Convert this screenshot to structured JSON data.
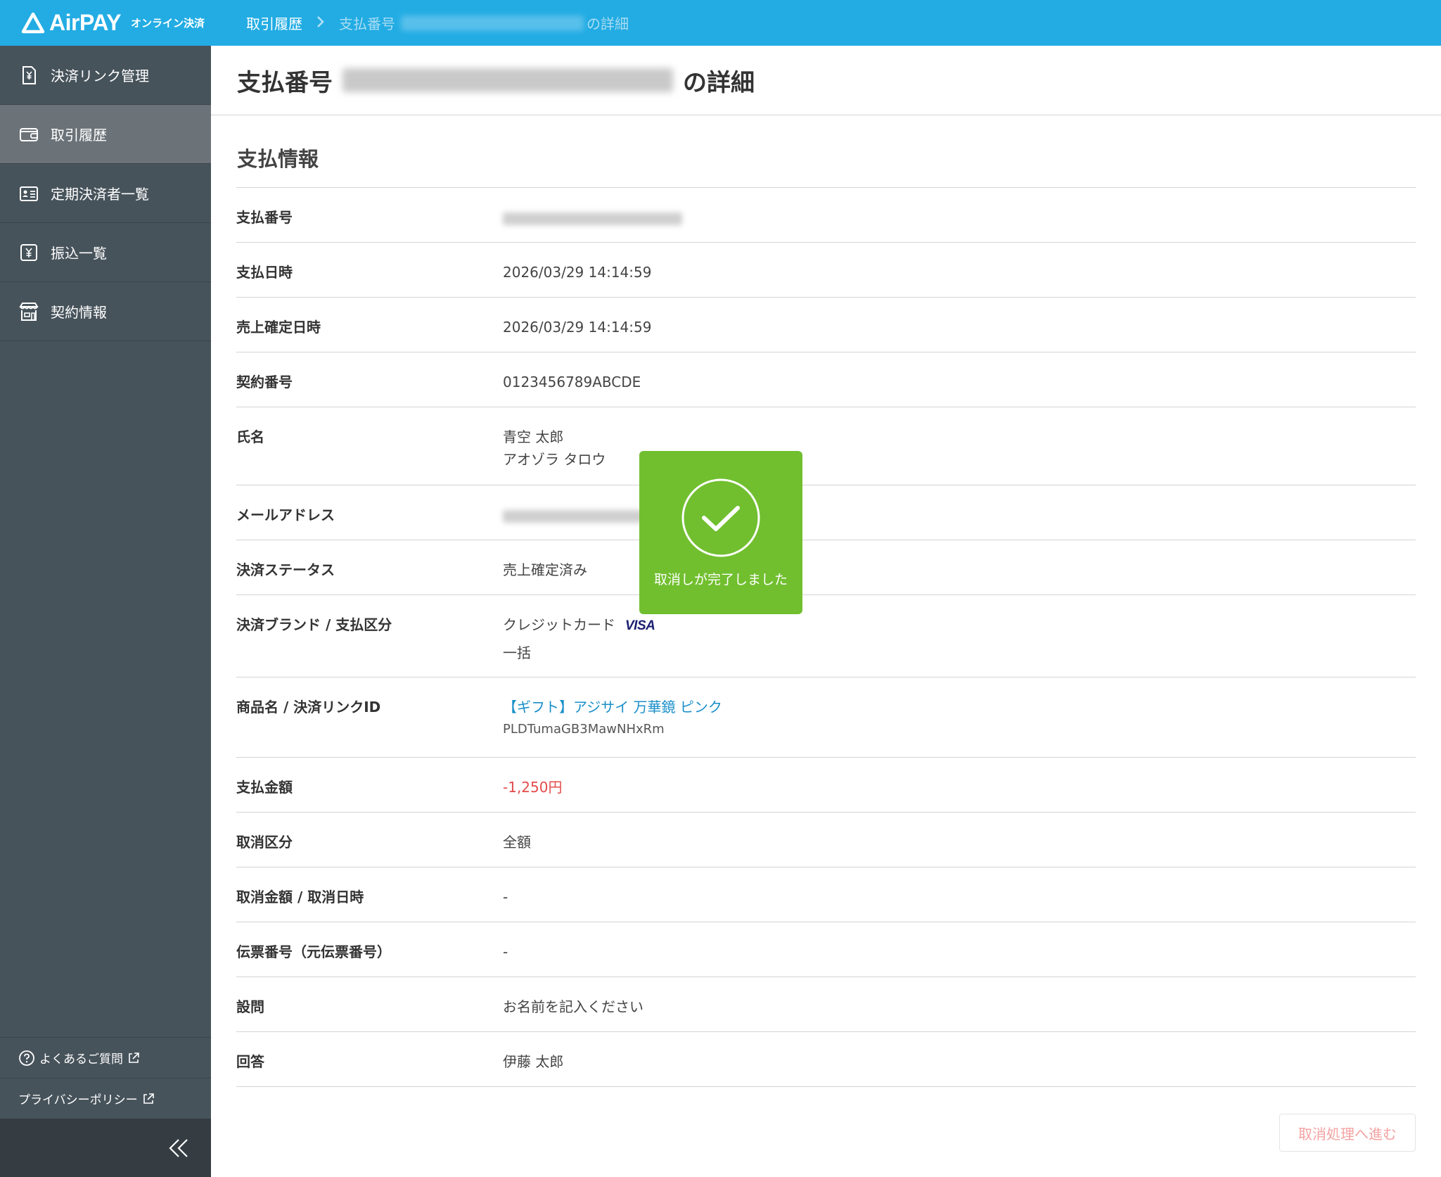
{
  "header": {
    "logo_text": "AirPAY",
    "logo_sub": "オンライン決済",
    "breadcrumb": {
      "parent": "取引履歴",
      "current_prefix": "支払番号",
      "current_suffix": "の詳細"
    }
  },
  "sidebar": {
    "items": [
      {
        "label": "決済リンク管理",
        "icon": "yen-document-icon"
      },
      {
        "label": "取引履歴",
        "icon": "wallet-icon"
      },
      {
        "label": "定期決済者一覧",
        "icon": "id-card-icon"
      },
      {
        "label": "振込一覧",
        "icon": "yen-transfer-icon"
      },
      {
        "label": "契約情報",
        "icon": "store-icon"
      }
    ],
    "active_index": 1,
    "footer": {
      "faq": "よくあるご質問",
      "privacy": "プライバシーポリシー"
    }
  },
  "page": {
    "title_prefix": "支払番号",
    "title_suffix": "の詳細",
    "section_title": "支払情報"
  },
  "details": {
    "payment_no_label": "支払番号",
    "payment_date_label": "支払日時",
    "payment_date": "2026/03/29 14:14:59",
    "sales_date_label": "売上確定日時",
    "sales_date": "2026/03/29 14:14:59",
    "contract_no_label": "契約番号",
    "contract_no": "0123456789ABCDE",
    "name_label": "氏名",
    "name": "青空 太郎",
    "name_kana": "アオゾラ タロウ",
    "email_label": "メールアドレス",
    "status_label": "決済ステータス",
    "status": "売上確定済み",
    "brand_label": "決済ブランド / 支払区分",
    "brand": "クレジットカード",
    "brand_logo": "VISA",
    "pay_type": "一括",
    "product_label": "商品名 / 決済リンクID",
    "product": "【ギフト】アジサイ 万華鏡 ピンク",
    "link_id": "PLDTumaGB3MawNHxRm",
    "amount_label": "支払金額",
    "amount": "-1,250円",
    "cancel_type_label": "取消区分",
    "cancel_type": "全額",
    "cancel_amount_label": "取消金額 / 取消日時",
    "cancel_amount": "-",
    "slip_label": "伝票番号（元伝票番号）",
    "slip": "-",
    "question_label": "設問",
    "question": "お名前を記入ください",
    "answer_label": "回答",
    "answer": "伊藤 太郎"
  },
  "buttons": {
    "cancel": "取消処理へ進む"
  },
  "toast": {
    "message": "取消しが完了しました"
  },
  "colors": {
    "header": "#22ace3",
    "sidebar": "#47535b",
    "toast": "#71bf2f",
    "link": "#1a8fc9",
    "negative": "#e34b4b"
  }
}
